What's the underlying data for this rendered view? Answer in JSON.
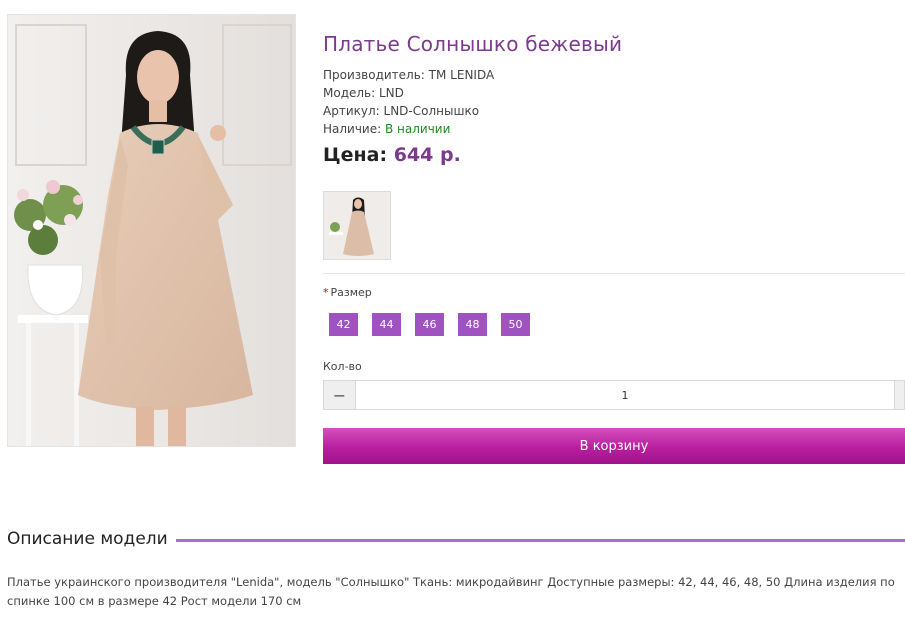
{
  "product": {
    "title": "Платье Солнышко бежевый",
    "manufacturer_label": "Производитель:",
    "manufacturer": "TM LENIDA",
    "model_label": "Модель:",
    "model": "LND",
    "sku_label": "Артикул:",
    "sku": "LND-Солнышко",
    "availability_label": "Наличие:",
    "availability": "В наличии",
    "price_label": "Цена:",
    "price": "644 р."
  },
  "options": {
    "required_mark": "*",
    "size_label": "Размер",
    "sizes": [
      "42",
      "44",
      "46",
      "48",
      "50"
    ],
    "qty_label": "Кол-во",
    "qty_value": "1",
    "minus_symbol": "−",
    "add_to_cart": "В корзину"
  },
  "description": {
    "heading": "Описание модели",
    "text": "Платье украинского производителя \"Lenida\", модель \"Солнышко\" Ткань: микродайвинг Доступные размеры: 42, 44, 46, 48, 50 Длина изделия по спинке 100 см в размере 42 Рост модели 170 см"
  },
  "colors": {
    "accent": "#7b3a8b",
    "size_button": "#a052c0",
    "cart_button": "#b81f9f",
    "in_stock": "#1f8a1f"
  }
}
